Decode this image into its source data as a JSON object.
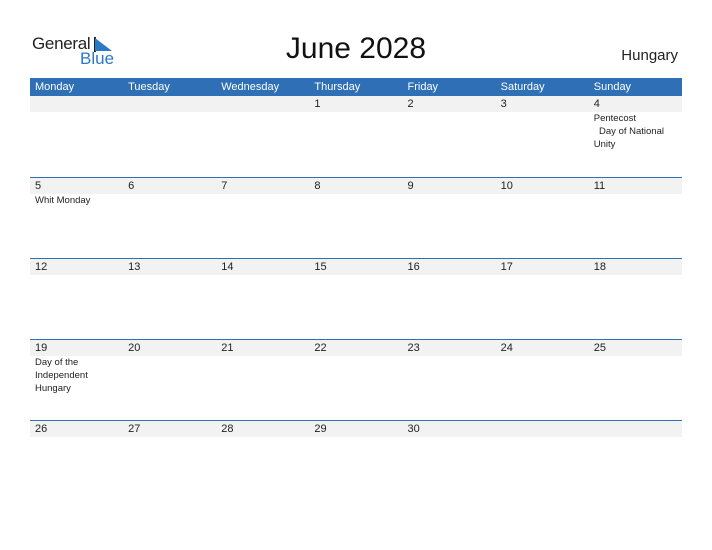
{
  "logo": {
    "general": "General",
    "blue": "Blue"
  },
  "title": "June 2028",
  "country": "Hungary",
  "colors": {
    "header_bg": "#2e6fb5",
    "logo_blue": "#2b78c5",
    "date_strip": "#f2f2f2"
  },
  "weekdays": [
    "Monday",
    "Tuesday",
    "Wednesday",
    "Thursday",
    "Friday",
    "Saturday",
    "Sunday"
  ],
  "weeks": [
    [
      {
        "day": "",
        "events": ""
      },
      {
        "day": "",
        "events": ""
      },
      {
        "day": "",
        "events": ""
      },
      {
        "day": "1",
        "events": ""
      },
      {
        "day": "2",
        "events": ""
      },
      {
        "day": "3",
        "events": ""
      },
      {
        "day": "4",
        "events": "Pentecost\n  Day of National Unity"
      }
    ],
    [
      {
        "day": "5",
        "events": "Whit Monday"
      },
      {
        "day": "6",
        "events": ""
      },
      {
        "day": "7",
        "events": ""
      },
      {
        "day": "8",
        "events": ""
      },
      {
        "day": "9",
        "events": ""
      },
      {
        "day": "10",
        "events": ""
      },
      {
        "day": "11",
        "events": ""
      }
    ],
    [
      {
        "day": "12",
        "events": ""
      },
      {
        "day": "13",
        "events": ""
      },
      {
        "day": "14",
        "events": ""
      },
      {
        "day": "15",
        "events": ""
      },
      {
        "day": "16",
        "events": ""
      },
      {
        "day": "17",
        "events": ""
      },
      {
        "day": "18",
        "events": ""
      }
    ],
    [
      {
        "day": "19",
        "events": "Day of the Independent Hungary"
      },
      {
        "day": "20",
        "events": ""
      },
      {
        "day": "21",
        "events": ""
      },
      {
        "day": "22",
        "events": ""
      },
      {
        "day": "23",
        "events": ""
      },
      {
        "day": "24",
        "events": ""
      },
      {
        "day": "25",
        "events": ""
      }
    ],
    [
      {
        "day": "26",
        "events": ""
      },
      {
        "day": "27",
        "events": ""
      },
      {
        "day": "28",
        "events": ""
      },
      {
        "day": "29",
        "events": ""
      },
      {
        "day": "30",
        "events": ""
      },
      {
        "day": "",
        "events": ""
      },
      {
        "day": "",
        "events": ""
      }
    ]
  ]
}
